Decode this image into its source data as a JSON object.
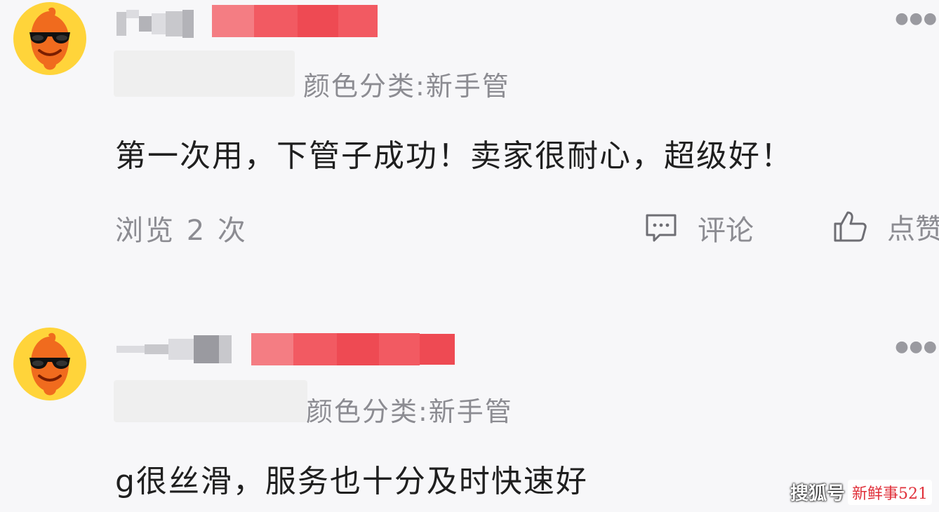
{
  "reviews": [
    {
      "category_label": "颜色分类:新手管",
      "text": "第一次用，下管子成功！卖家很耐心，超级好！",
      "views": "浏览 2 次",
      "comment_label": "评论",
      "like_label": "点赞",
      "more_icon": "more-dots-icon"
    },
    {
      "category_label": "颜色分类:新手管",
      "text": "g很丝滑，服务也十分及时快速好",
      "more_icon": "more-dots-icon"
    }
  ],
  "watermark": {
    "brand": "搜狐号",
    "author": "新鲜事521"
  },
  "colors": {
    "background": "#f7f7f9",
    "avatar_yellow": "#ffd43a",
    "avatar_orange": "#f06b1e",
    "blur_red": "#f25a62",
    "meta_gray": "#8c8c92",
    "watermark_red": "#e0303a"
  }
}
